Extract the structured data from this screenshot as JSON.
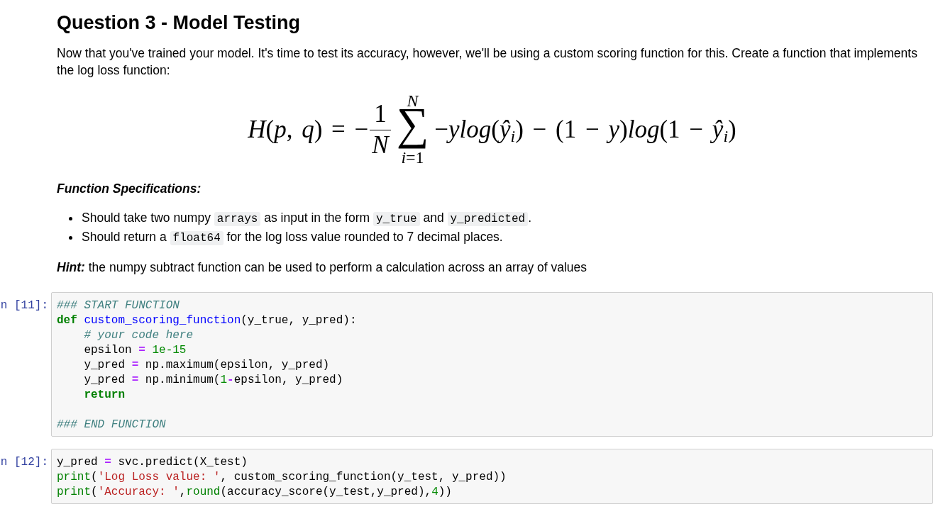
{
  "title": "Question 3 - Model Testing",
  "intro": "Now that you've trained your model. It's time to test its accuracy, however, we'll be using a custom scoring function for this. Create a function that implements the log loss function:",
  "formula": {
    "lhs": "*H*(*p*, *q*) = −",
    "fraction": {
      "numerator": "1",
      "denominator": "N"
    },
    "sum": {
      "symbol": "∑",
      "upper": "N",
      "lower": "*i*=1"
    },
    "body": "−*ylog*(*ŷ*$_{i}$) − (1 − *y*)*log*(1 − *ŷ*$_{i}$)"
  },
  "spec_heading": "Function Specifications:",
  "spec_items": [
    {
      "segments": [
        {
          "kind": "text",
          "text": "Should take two numpy "
        },
        {
          "kind": "code",
          "text": "arrays"
        },
        {
          "kind": "text",
          "text": " as input in the form "
        },
        {
          "kind": "code",
          "text": "y_true"
        },
        {
          "kind": "text",
          "text": " and "
        },
        {
          "kind": "code",
          "text": "y_predicted"
        },
        {
          "kind": "text",
          "text": "."
        }
      ]
    },
    {
      "segments": [
        {
          "kind": "text",
          "text": "Should return a "
        },
        {
          "kind": "code",
          "text": "float64"
        },
        {
          "kind": "text",
          "text": " for the log loss value rounded to 7 decimal places."
        }
      ]
    }
  ],
  "hint": {
    "label": "Hint:",
    "text": "the numpy subtract function can be used to perform a calculation across an array of values"
  },
  "cells": [
    {
      "prompt": "n [11]:",
      "lines": [
        {
          "kind": "code",
          "tokens": [
            {
              "kind": "comment",
              "text": "### START FUNCTION"
            }
          ]
        },
        {
          "kind": "code",
          "tokens": [
            {
              "kind": "keyword",
              "text": "def "
            },
            {
              "kind": "name",
              "text": "custom_scoring_function"
            },
            {
              "kind": "plain",
              "text": "(y_true, y_pred):"
            }
          ]
        },
        {
          "kind": "code",
          "tokens": [
            {
              "kind": "comment",
              "text": "    # your code here"
            }
          ]
        },
        {
          "kind": "code",
          "tokens": [
            {
              "kind": "plain",
              "text": "    epsilon "
            },
            {
              "kind": "operator",
              "text": "="
            },
            {
              "kind": "number",
              "text": " 1e-15"
            }
          ]
        },
        {
          "kind": "code",
          "tokens": [
            {
              "kind": "plain",
              "text": "    y_pred "
            },
            {
              "kind": "operator",
              "text": "="
            },
            {
              "kind": "plain",
              "text": " np.maximum(epsilon, y_pred)"
            }
          ]
        },
        {
          "kind": "code",
          "tokens": [
            {
              "kind": "plain",
              "text": "    y_pred "
            },
            {
              "kind": "operator",
              "text": "="
            },
            {
              "kind": "plain",
              "text": " np.minimum("
            },
            {
              "kind": "number",
              "text": "1"
            },
            {
              "kind": "operator",
              "text": "-"
            },
            {
              "kind": "plain",
              "text": "epsilon, y_pred)"
            }
          ]
        },
        {
          "kind": "code",
          "tokens": [
            {
              "kind": "keyword",
              "text": "    return"
            }
          ]
        },
        {
          "kind": "blank"
        },
        {
          "kind": "code",
          "tokens": [
            {
              "kind": "comment",
              "text": "### END FUNCTION"
            }
          ]
        }
      ]
    },
    {
      "prompt": "n [12]:",
      "lines": [
        {
          "kind": "code",
          "tokens": [
            {
              "kind": "plain",
              "text": "y_pred "
            },
            {
              "kind": "operator",
              "text": "="
            },
            {
              "kind": "plain",
              "text": " svc.predict(X_test)"
            }
          ]
        },
        {
          "kind": "code",
          "tokens": [
            {
              "kind": "builtin",
              "text": "print"
            },
            {
              "kind": "plain",
              "text": "("
            },
            {
              "kind": "string",
              "text": "'Log Loss value: '"
            },
            {
              "kind": "plain",
              "text": ", custom_scoring_function(y_test, y_pred))"
            }
          ]
        },
        {
          "kind": "code",
          "tokens": [
            {
              "kind": "builtin",
              "text": "print"
            },
            {
              "kind": "plain",
              "text": "("
            },
            {
              "kind": "string",
              "text": "'Accuracy: '"
            },
            {
              "kind": "plain",
              "text": ","
            },
            {
              "kind": "builtin",
              "text": "round"
            },
            {
              "kind": "plain",
              "text": "(accuracy_score(y_test,y_pred),"
            },
            {
              "kind": "number",
              "text": "4"
            },
            {
              "kind": "plain",
              "text": "))"
            }
          ]
        }
      ]
    }
  ]
}
